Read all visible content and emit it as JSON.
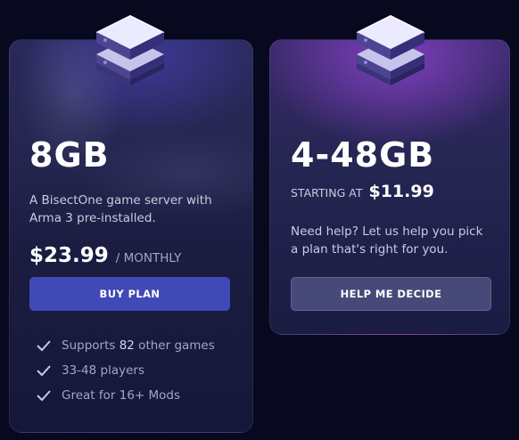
{
  "plans": [
    {
      "size": "8GB",
      "description": "A BisectOne game server with Arma 3 pre-installed.",
      "price": "$23.99",
      "period": "/ MONTHLY",
      "button_label": "BUY PLAN",
      "features": [
        {
          "prefix": "Supports ",
          "highlight": "82",
          "suffix": " other games"
        },
        {
          "prefix": "33-48 players",
          "highlight": "",
          "suffix": ""
        },
        {
          "prefix": "Great for 16+ Mods",
          "highlight": "",
          "suffix": ""
        }
      ],
      "icon": "server-stack-icon"
    },
    {
      "size": "4-48GB",
      "starting_label": "STARTING AT",
      "starting_price": "$11.99",
      "help_text": "Need help? Let us help you pick a plan that's right for you.",
      "button_label": "HELP ME DECIDE",
      "icon": "server-stack-icon"
    }
  ],
  "colors": {
    "background": "#08081f",
    "primary_button": "#4049b6",
    "secondary_button": "#474a78",
    "text_muted": "#a3a6c6"
  }
}
